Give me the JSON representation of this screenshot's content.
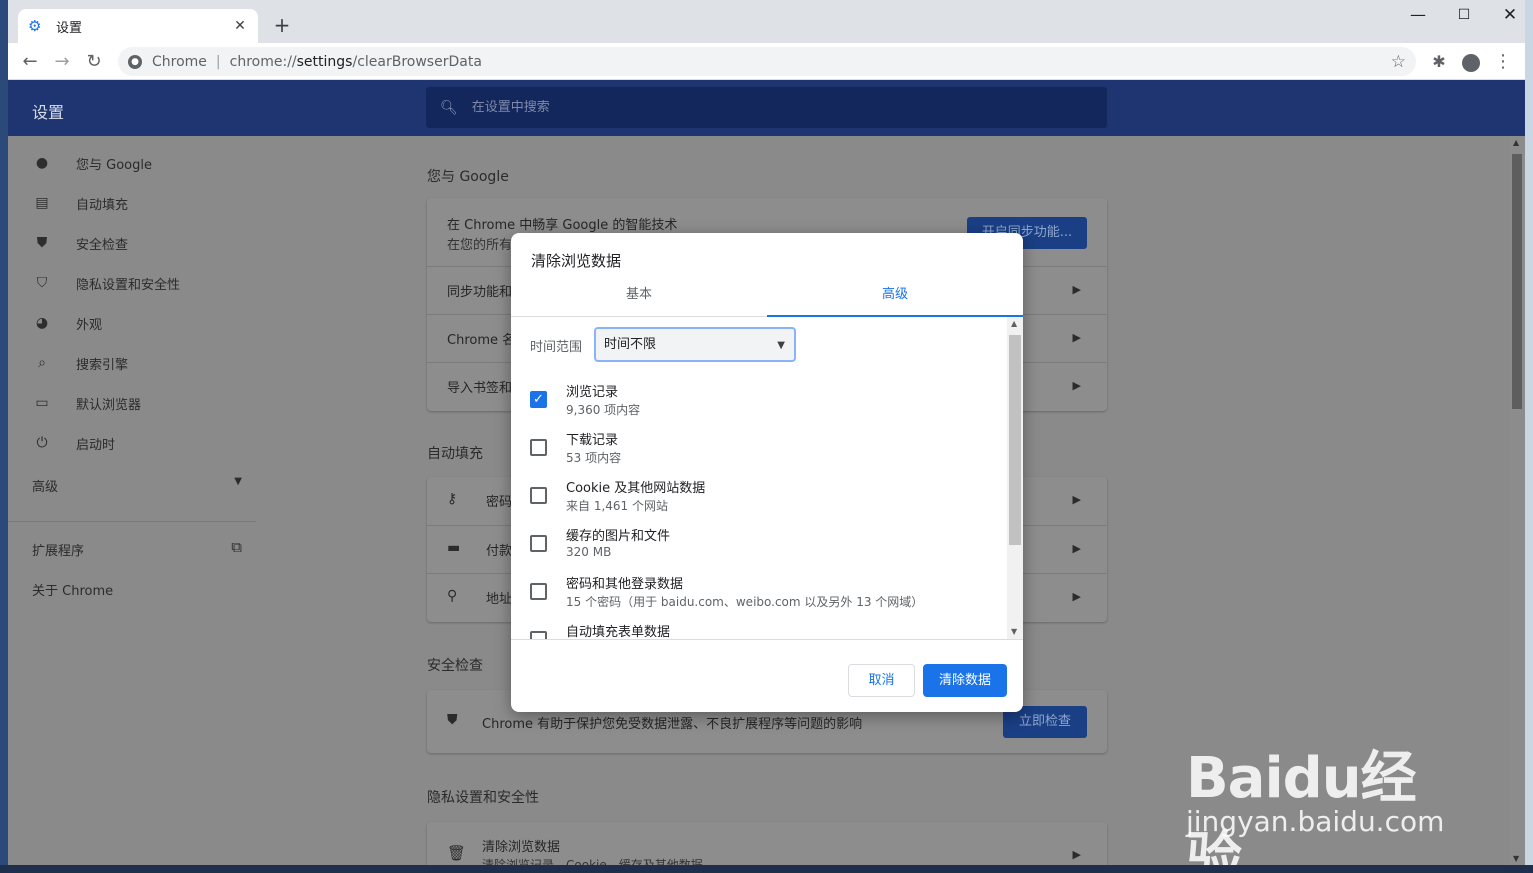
{
  "browser": {
    "tab_title": "设置",
    "omnibox_site": "Chrome",
    "omnibox_url_prefix": "chrome://",
    "omnibox_url_path": "settings",
    "omnibox_url_rest": "/clearBrowserData"
  },
  "settings_header": {
    "title": "设置",
    "search_placeholder": "在设置中搜索"
  },
  "sidebar": {
    "items": [
      {
        "label": "您与 Google",
        "icon": "person-icon"
      },
      {
        "label": "自动填充",
        "icon": "clipboard-icon"
      },
      {
        "label": "安全检查",
        "icon": "shield-check-icon"
      },
      {
        "label": "隐私设置和安全性",
        "icon": "shield-icon"
      },
      {
        "label": "外观",
        "icon": "palette-icon"
      },
      {
        "label": "搜索引擎",
        "icon": "search-icon"
      },
      {
        "label": "默认浏览器",
        "icon": "browser-icon"
      },
      {
        "label": "启动时",
        "icon": "power-icon"
      }
    ],
    "advanced": "高级",
    "extensions": "扩展程序",
    "about": "关于 Chrome"
  },
  "main": {
    "section_you_google": "您与 Google",
    "card1_title": "在 Chrome 中畅享 Google 的智能技术",
    "card1_sub": "在您的所有",
    "sync_button": "开启同步功能...",
    "row_sync": "同步功能和",
    "row_chrome_name": "Chrome 名",
    "row_import": "导入书签和",
    "section_autofill": "自动填充",
    "row_passwords": "密码",
    "row_payments": "付款",
    "row_addresses": "地址",
    "section_safety": "安全检查",
    "safety_text": "Chrome 有助于保护您免受数据泄露、不良扩展程序等问题的影响",
    "safety_button": "立即检查",
    "section_privacy": "隐私设置和安全性",
    "clear_title": "清除浏览数据",
    "clear_sub": "清除浏览记录、Cookie、缓存及其他数据"
  },
  "dialog": {
    "title": "清除浏览数据",
    "tab_basic": "基本",
    "tab_advanced": "高级",
    "range_label": "时间范围",
    "range_value": "时间不限",
    "options": [
      {
        "title": "浏览记录",
        "sub": "9,360 项内容",
        "checked": true
      },
      {
        "title": "下载记录",
        "sub": "53 项内容",
        "checked": false
      },
      {
        "title": "Cookie 及其他网站数据",
        "sub": "来自 1,461 个网站",
        "checked": false
      },
      {
        "title": "缓存的图片和文件",
        "sub": "320 MB",
        "checked": false
      },
      {
        "title": "密码和其他登录数据",
        "sub": "15 个密码（用于 baidu.com、weibo.com 以及另外 13 个网域）",
        "checked": false
      },
      {
        "title": "自动填充表单数据",
        "sub": "",
        "checked": false
      }
    ],
    "cancel": "取消",
    "clear": "清除数据"
  },
  "watermark": {
    "main": "Baidu经验",
    "sub": "jingyan.baidu.com"
  },
  "colors": {
    "accent": "#1a73e8",
    "header": "#1f3572"
  }
}
